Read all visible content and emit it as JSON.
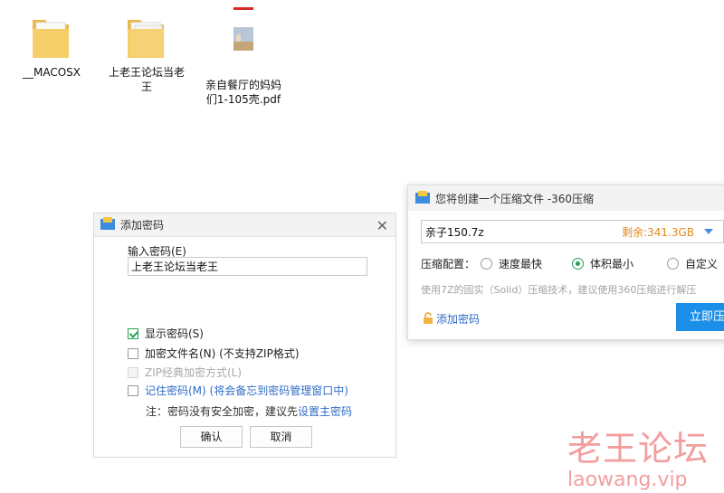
{
  "desktop": {
    "icons": [
      {
        "label": "__MACOSX",
        "type": "folder"
      },
      {
        "label": "上老王论坛当老王",
        "type": "folder"
      },
      {
        "label": "亲自餐厅的妈妈们1-105壳.pdf",
        "type": "pdf"
      }
    ]
  },
  "password_dialog": {
    "title": "添加密码",
    "input_label": "输入密码(E)",
    "input_value": "上老王论坛当老王",
    "options": [
      {
        "label": "显示密码(S)",
        "checked": true,
        "disabled": false
      },
      {
        "label": "加密文件名(N) (不支持ZIP格式)",
        "checked": false,
        "disabled": false
      },
      {
        "label": "ZIP经典加密方式(L)",
        "checked": false,
        "disabled": true
      },
      {
        "label": "记住密码(M) (将会备忘到密码管理窗口中)",
        "checked": false,
        "disabled": false
      }
    ],
    "note_prefix": "注：密码没有安全加密，建议先",
    "note_link": "设置主密码",
    "ok_label": "确认",
    "cancel_label": "取消"
  },
  "compress_dialog": {
    "title": "您将创建一个压缩文件 -360压缩",
    "filename": "亲子150.7z",
    "free_space": "剩余:341.3GB",
    "config_label": "压缩配置：",
    "config_options": [
      {
        "label": "速度最快",
        "selected": false
      },
      {
        "label": "体积最小",
        "selected": true
      },
      {
        "label": "自定义",
        "selected": false
      }
    ],
    "hint": "使用7Z的固实（Solid）压缩技术，建议使用360压缩进行解压",
    "add_password": "添加密码",
    "compress_button": "立即压缩"
  },
  "watermark": {
    "cn": "老王论坛",
    "en": "laowang.vip"
  },
  "colors": {
    "accent_blue": "#1b8fe8",
    "link_blue": "#2f6cc6",
    "check_green": "#25a054",
    "space_orange": "#e08a1e",
    "watermark_red": "#f29e9e"
  }
}
